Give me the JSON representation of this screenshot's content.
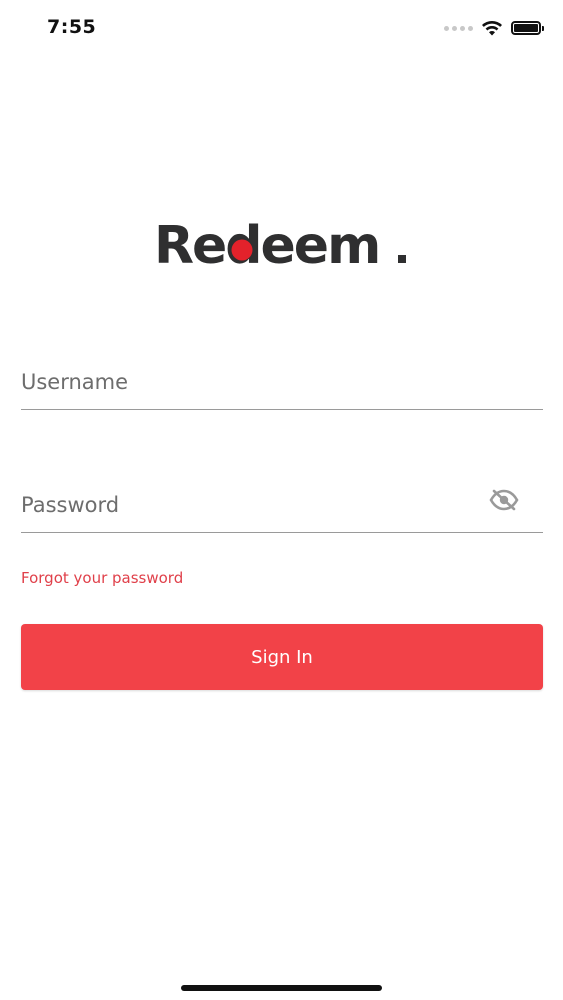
{
  "status_bar": {
    "time": "7:55",
    "icons": [
      "cellular-signal-icon",
      "wifi-icon",
      "battery-icon"
    ]
  },
  "logo": {
    "text": "Redeem.",
    "colors": {
      "text": "#2f2f30",
      "dot": "#e3222b"
    }
  },
  "form": {
    "username": {
      "placeholder": "Username",
      "value": ""
    },
    "password": {
      "placeholder": "Password",
      "value": "",
      "toggle_icon": "eye-off-icon"
    },
    "forgot_link": "Forgot your password",
    "sign_in_label": "Sign In"
  },
  "colors": {
    "accent": "#f24248",
    "link": "#e0404a",
    "divider": "#9a9a9a"
  }
}
